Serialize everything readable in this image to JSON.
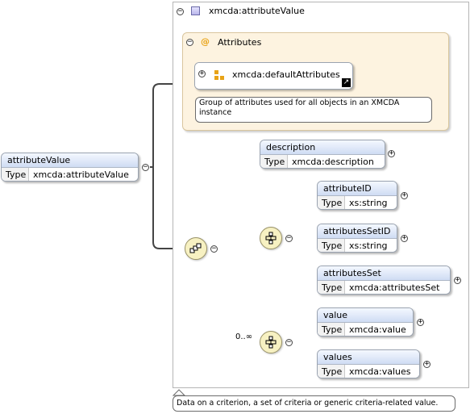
{
  "root": {
    "name": "attributeValue",
    "type_key": "Type",
    "type_value": "xmcda:attributeValue"
  },
  "panel_title": "xmcda:attributeValue",
  "attributes_title": "Attributes",
  "attribute_group": {
    "name": "xmcda:defaultAttributes",
    "annotation": "Group of attributes used for all objects in an XMCDA instance"
  },
  "description_node": {
    "name": "description",
    "type_key": "Type",
    "type_value": "xmcda:description"
  },
  "sequence_children": [
    {
      "name": "attributeID",
      "type_key": "Type",
      "type_value": "xs:string"
    },
    {
      "name": "attributesSetID",
      "type_key": "Type",
      "type_value": "xs:string"
    },
    {
      "name": "attributesSet",
      "type_key": "Type",
      "type_value": "xmcda:attributesSet"
    }
  ],
  "choice_children": [
    {
      "name": "value",
      "type_key": "Type",
      "type_value": "xmcda:value"
    },
    {
      "name": "values",
      "type_key": "Type",
      "type_value": "xmcda:values"
    }
  ],
  "occurrence": "0..∞",
  "bottom_annotation": "Data on a criterion, a set of criteria or generic criteria-related value.",
  "colors": {
    "header": "#cfdcf3",
    "attributes_bg": "#fdf3e0",
    "compositor": "#f7f1c2",
    "attribute_icon": "#e8a317"
  },
  "icons": [
    "collapse-icon",
    "expand-icon",
    "complex-type-icon",
    "attribute-group-icon",
    "sequence-icon",
    "link-arrow-icon"
  ]
}
